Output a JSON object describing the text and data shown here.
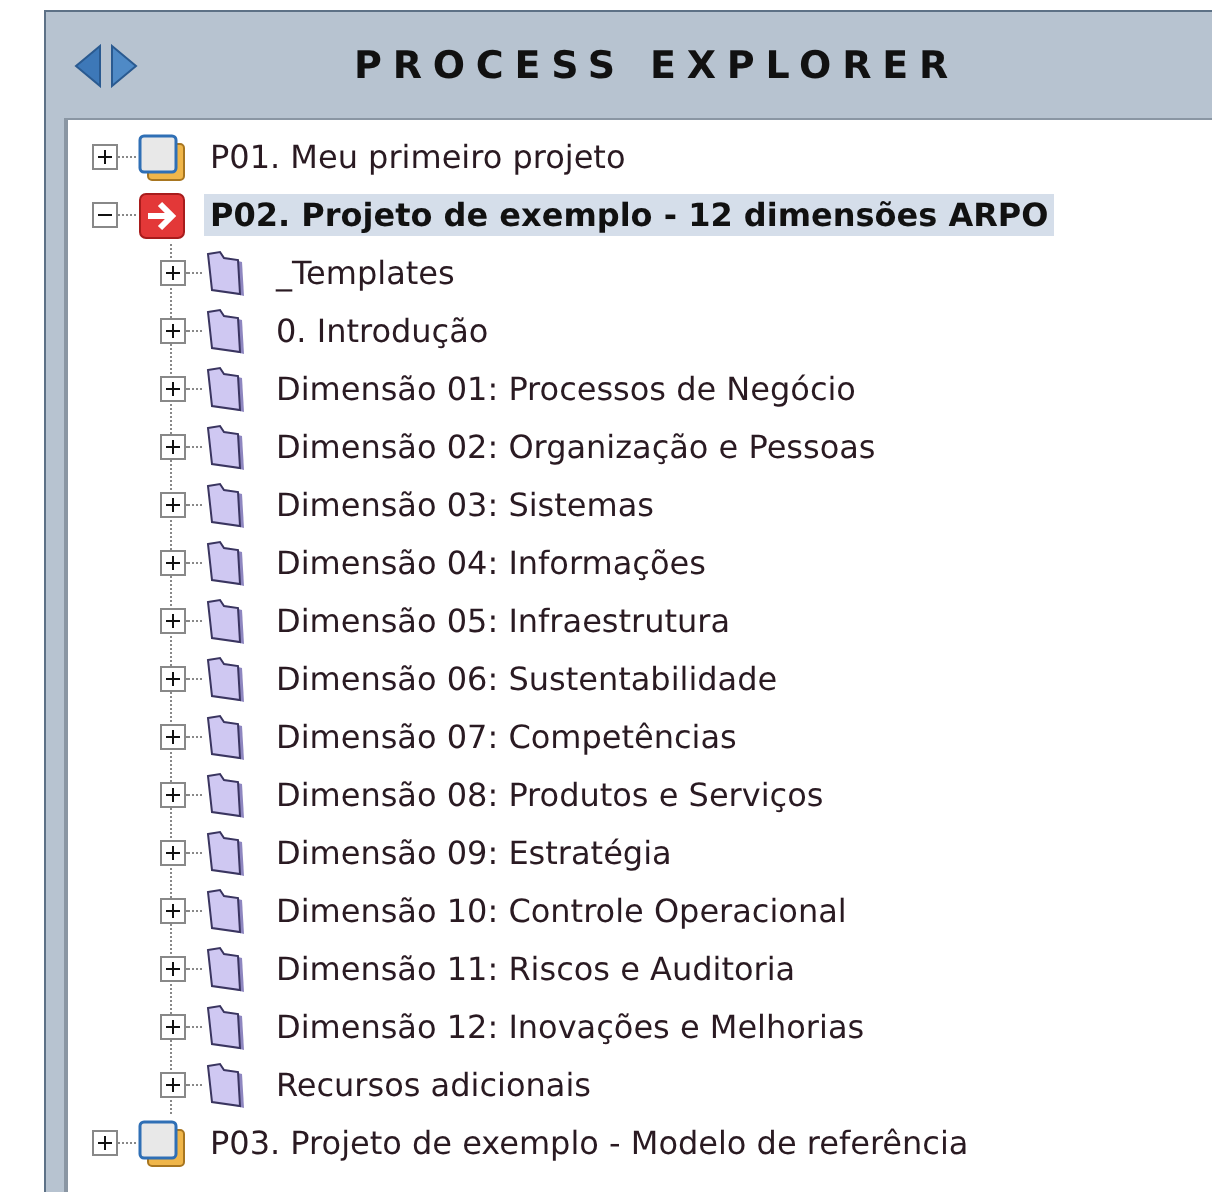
{
  "header": {
    "title": "PROCESS EXPLORER"
  },
  "tree": [
    {
      "label": "P01. Meu primeiro projeto",
      "kind": "project",
      "selected": false,
      "expanded": false
    },
    {
      "label": "P02. Projeto de exemplo - 12 dimensões ARPO",
      "kind": "active-project",
      "selected": true,
      "expanded": true,
      "children": [
        {
          "label": "_Templates",
          "kind": "folder",
          "selected": false,
          "expanded": false
        },
        {
          "label": "0. Introdução",
          "kind": "folder",
          "selected": false,
          "expanded": false
        },
        {
          "label": "Dimensão 01: Processos de Negócio",
          "kind": "folder",
          "selected": false,
          "expanded": false
        },
        {
          "label": "Dimensão 02: Organização e Pessoas",
          "kind": "folder",
          "selected": false,
          "expanded": false
        },
        {
          "label": "Dimensão 03: Sistemas",
          "kind": "folder",
          "selected": false,
          "expanded": false
        },
        {
          "label": "Dimensão 04: Informações",
          "kind": "folder",
          "selected": false,
          "expanded": false
        },
        {
          "label": "Dimensão 05: Infraestrutura",
          "kind": "folder",
          "selected": false,
          "expanded": false
        },
        {
          "label": "Dimensão 06: Sustentabilidade",
          "kind": "folder",
          "selected": false,
          "expanded": false
        },
        {
          "label": "Dimensão 07: Competências",
          "kind": "folder",
          "selected": false,
          "expanded": false
        },
        {
          "label": "Dimensão 08: Produtos e Serviços",
          "kind": "folder",
          "selected": false,
          "expanded": false
        },
        {
          "label": "Dimensão 09: Estratégia",
          "kind": "folder",
          "selected": false,
          "expanded": false
        },
        {
          "label": "Dimensão 10: Controle Operacional",
          "kind": "folder",
          "selected": false,
          "expanded": false
        },
        {
          "label": "Dimensão 11: Riscos e Auditoria",
          "kind": "folder",
          "selected": false,
          "expanded": false
        },
        {
          "label": "Dimensão 12: Inovações e Melhorias",
          "kind": "folder",
          "selected": false,
          "expanded": false
        },
        {
          "label": "Recursos adicionais",
          "kind": "folder",
          "selected": false,
          "expanded": false
        }
      ]
    },
    {
      "label": "P03. Projeto de exemplo - Modelo de referência",
      "kind": "project",
      "selected": false,
      "expanded": false
    }
  ]
}
